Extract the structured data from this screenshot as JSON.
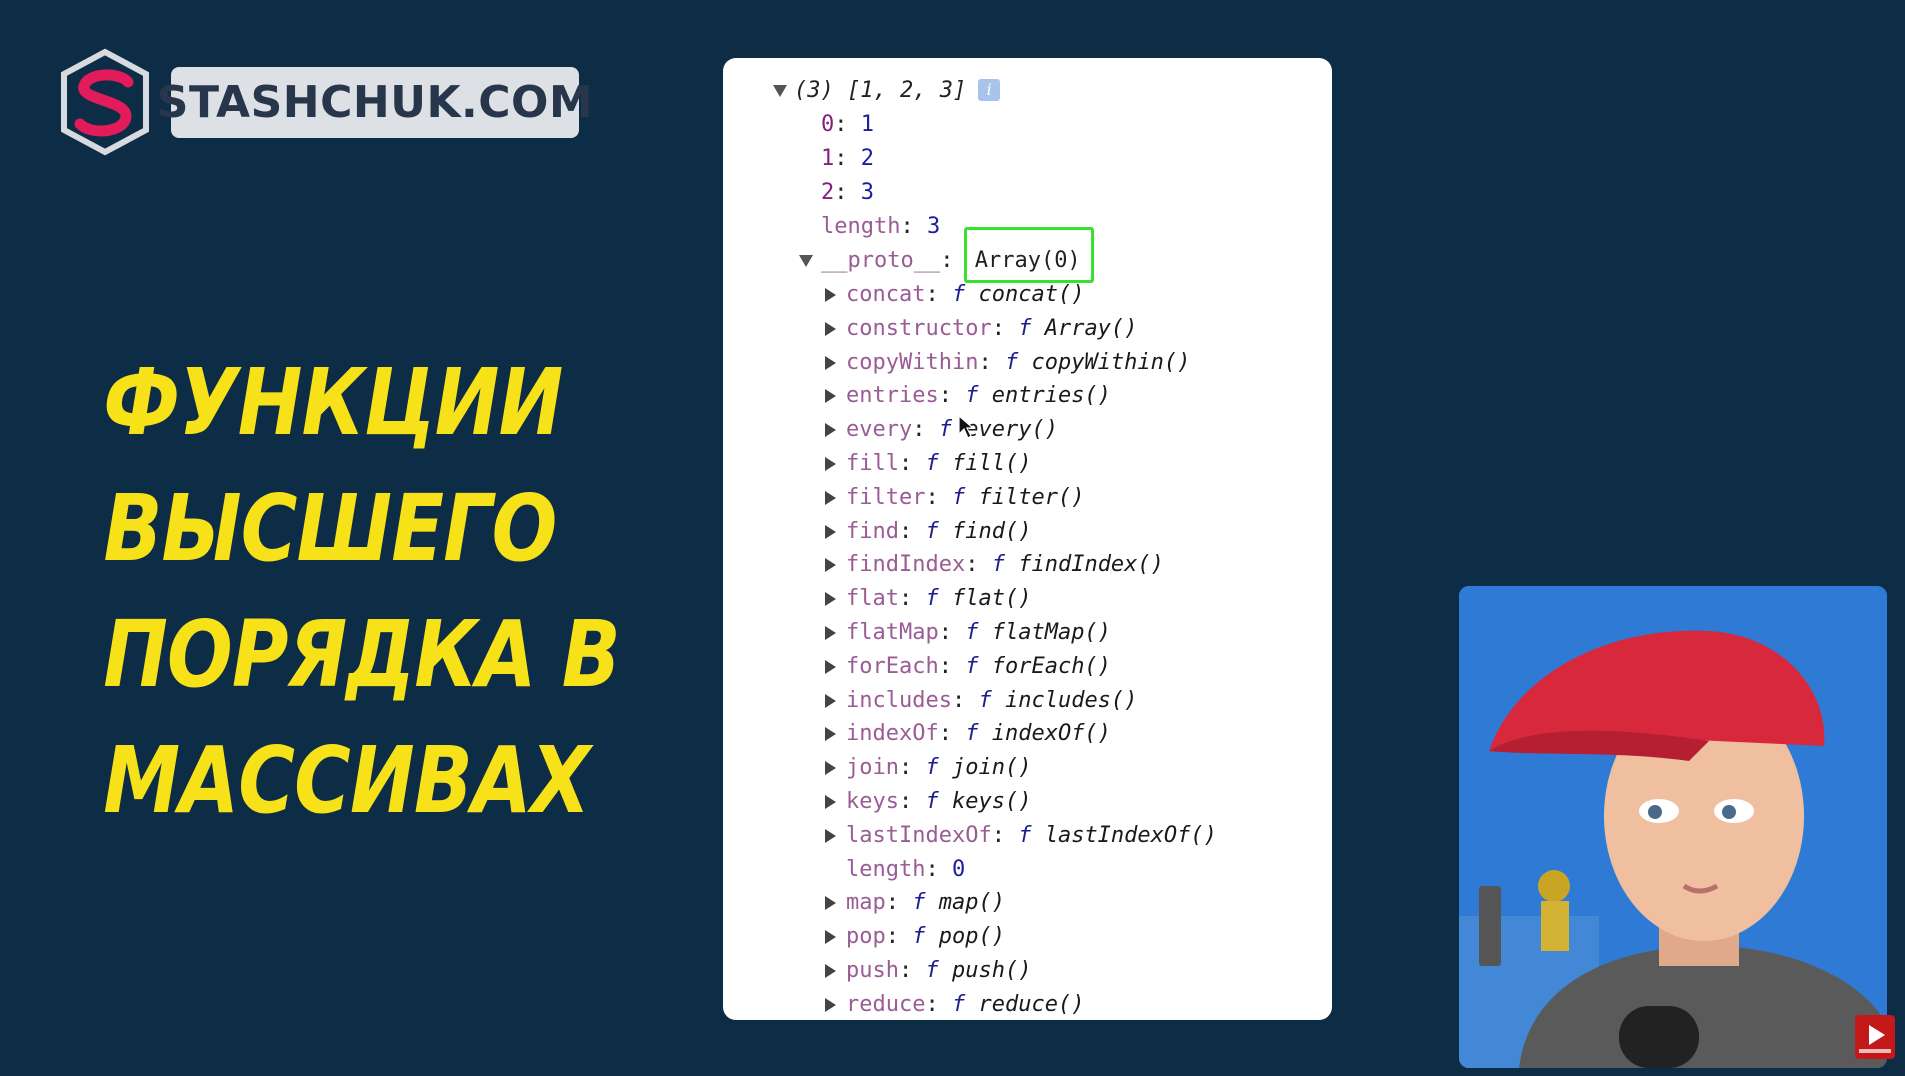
{
  "brand": {
    "logo_text": "STASHCHUK.COM",
    "accent_color": "#e21b5a",
    "icon": "stashchuk-s-logo-icon"
  },
  "title": {
    "lines": [
      "ФУНКЦИИ",
      "ВЫСШЕГО",
      "ПОРЯДКА В",
      "МАССИВАХ"
    ],
    "color": "#f7e21a"
  },
  "console": {
    "header": "(3) [1, 2, 3]",
    "info_icon": "i",
    "own_entries": [
      {
        "key": "0",
        "sep": ": ",
        "value": "1"
      },
      {
        "key": "1",
        "sep": ": ",
        "value": "2"
      },
      {
        "key": "2",
        "sep": ": ",
        "value": "3"
      },
      {
        "key": "length",
        "sep": ": ",
        "value": "3"
      }
    ],
    "proto": {
      "key": "__proto__",
      "sep": ": ",
      "value": "Array(0)"
    },
    "proto_entries": [
      {
        "key": "concat",
        "sig": "concat()"
      },
      {
        "key": "constructor",
        "sig": "Array()"
      },
      {
        "key": "copyWithin",
        "sig": "copyWithin()"
      },
      {
        "key": "entries",
        "sig": "entries()"
      },
      {
        "key": "every",
        "sig": "every()"
      },
      {
        "key": "fill",
        "sig": "fill()"
      },
      {
        "key": "filter",
        "sig": "filter()"
      },
      {
        "key": "find",
        "sig": "find()"
      },
      {
        "key": "findIndex",
        "sig": "findIndex()"
      },
      {
        "key": "flat",
        "sig": "flat()"
      },
      {
        "key": "flatMap",
        "sig": "flatMap()"
      },
      {
        "key": "forEach",
        "sig": "forEach()"
      },
      {
        "key": "includes",
        "sig": "includes()"
      },
      {
        "key": "indexOf",
        "sig": "indexOf()"
      },
      {
        "key": "join",
        "sig": "join()"
      },
      {
        "key": "keys",
        "sig": "keys()"
      },
      {
        "key": "lastIndexOf",
        "sig": "lastIndexOf()"
      },
      {
        "key": "length",
        "value": "0"
      },
      {
        "key": "map",
        "sig": "map()"
      },
      {
        "key": "pop",
        "sig": "pop()"
      },
      {
        "key": "push",
        "sig": "push()"
      },
      {
        "key": "reduce",
        "sig": "reduce()"
      }
    ],
    "f_symbol": "f",
    "highlight_color": "#37e12d"
  },
  "webcam": {
    "icon": "presenter-video-feed"
  },
  "subscribe": {
    "icon": "youtube-subscribe-icon"
  }
}
